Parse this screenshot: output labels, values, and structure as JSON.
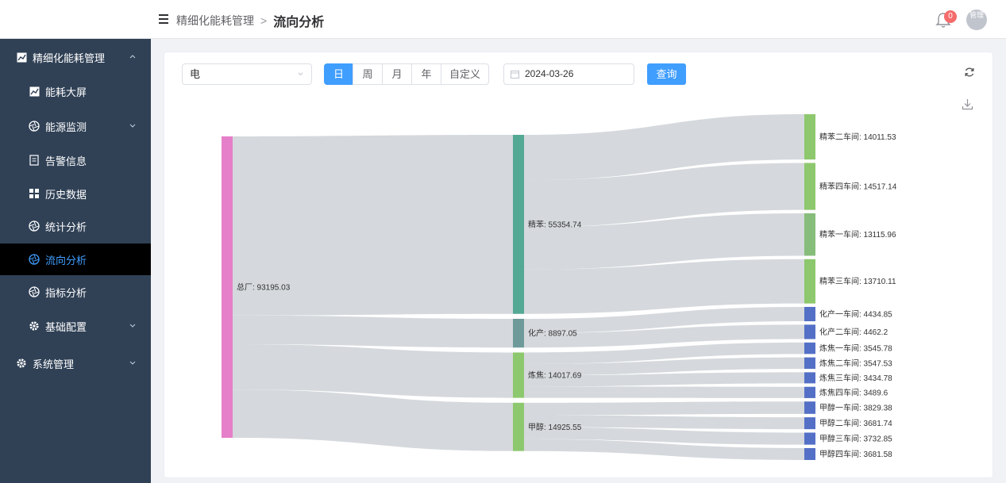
{
  "header": {
    "breadcrumb_parent": "精细化能耗管理",
    "breadcrumb_sep": ">",
    "breadcrumb_current": "流向分析",
    "notification_count": "0",
    "avatar_text": "管理"
  },
  "sidebar": {
    "items": [
      {
        "label": "精细化能耗管理",
        "icon": "line-chart-icon",
        "level": "top",
        "expanded": true
      },
      {
        "label": "能耗大屏",
        "icon": "line-chart-icon",
        "level": "sub"
      },
      {
        "label": "能源监测",
        "icon": "aperture-icon",
        "level": "sub",
        "expandable": true
      },
      {
        "label": "告警信息",
        "icon": "document-icon",
        "level": "sub"
      },
      {
        "label": "历史数据",
        "icon": "grid-icon",
        "level": "sub"
      },
      {
        "label": "统计分析",
        "icon": "aperture-icon",
        "level": "sub"
      },
      {
        "label": "流向分析",
        "icon": "aperture-icon",
        "level": "sub",
        "active": true
      },
      {
        "label": "指标分析",
        "icon": "aperture-icon",
        "level": "sub"
      },
      {
        "label": "基础配置",
        "icon": "gear-icon",
        "level": "sub",
        "expandable": true
      },
      {
        "label": "系统管理",
        "icon": "gear-icon",
        "level": "top",
        "expandable": true
      }
    ]
  },
  "toolbar": {
    "energy_type": "电",
    "periods": [
      "日",
      "周",
      "月",
      "年",
      "自定义"
    ],
    "active_period": "日",
    "date_value": "2024-03-26",
    "query_label": "查询"
  },
  "chart_data": {
    "type": "sankey",
    "nodes": [
      {
        "name": "总厂",
        "value": 93195.03,
        "color": "#e67fca"
      },
      {
        "name": "精苯",
        "value": 55354.74,
        "color": "#54a994"
      },
      {
        "name": "化产",
        "value": 8897.05,
        "color": "#6f9a9a"
      },
      {
        "name": "炼焦",
        "value": 14017.69,
        "color": "#8dc86e"
      },
      {
        "name": "甲醇",
        "value": 14925.55,
        "color": "#8dc86e"
      },
      {
        "name": "精苯二车间",
        "value": 14011.53,
        "color": "#8dc86e"
      },
      {
        "name": "精苯四车间",
        "value": 14517.14,
        "color": "#8dc86e"
      },
      {
        "name": "精苯一车间",
        "value": 13115.96,
        "color": "#86bd7a"
      },
      {
        "name": "精苯三车间",
        "value": 13710.11,
        "color": "#8dc86e"
      },
      {
        "name": "化产一车间",
        "value": 4434.85,
        "color": "#5470c6"
      },
      {
        "name": "化产二车间",
        "value": 4462.2,
        "color": "#5470c6"
      },
      {
        "name": "炼焦一车间",
        "value": 3545.78,
        "color": "#5470c6"
      },
      {
        "name": "炼焦二车间",
        "value": 3547.53,
        "color": "#5470c6"
      },
      {
        "name": "炼焦三车间",
        "value": 3434.78,
        "color": "#5470c6"
      },
      {
        "name": "炼焦四车间",
        "value": 3489.6,
        "color": "#5470c6"
      },
      {
        "name": "甲醇一车间",
        "value": 3829.38,
        "color": "#5470c6"
      },
      {
        "name": "甲醇二车间",
        "value": 3681.74,
        "color": "#5470c6"
      },
      {
        "name": "甲醇三车间",
        "value": 3732.85,
        "color": "#5470c6"
      },
      {
        "name": "甲醇四车间",
        "value": 3681.58,
        "color": "#5470c6"
      }
    ],
    "links": [
      {
        "source": "总厂",
        "target": "精苯",
        "value": 55354.74
      },
      {
        "source": "总厂",
        "target": "化产",
        "value": 8897.05
      },
      {
        "source": "总厂",
        "target": "炼焦",
        "value": 14017.69
      },
      {
        "source": "总厂",
        "target": "甲醇",
        "value": 14925.55
      },
      {
        "source": "精苯",
        "target": "精苯二车间",
        "value": 14011.53
      },
      {
        "source": "精苯",
        "target": "精苯四车间",
        "value": 14517.14
      },
      {
        "source": "精苯",
        "target": "精苯一车间",
        "value": 13115.96
      },
      {
        "source": "精苯",
        "target": "精苯三车间",
        "value": 13710.11
      },
      {
        "source": "化产",
        "target": "化产一车间",
        "value": 4434.85
      },
      {
        "source": "化产",
        "target": "化产二车间",
        "value": 4462.2
      },
      {
        "source": "炼焦",
        "target": "炼焦一车间",
        "value": 3545.78
      },
      {
        "source": "炼焦",
        "target": "炼焦二车间",
        "value": 3547.53
      },
      {
        "source": "炼焦",
        "target": "炼焦三车间",
        "value": 3434.78
      },
      {
        "source": "炼焦",
        "target": "炼焦四车间",
        "value": 3489.6
      },
      {
        "source": "甲醇",
        "target": "甲醇一车间",
        "value": 3829.38
      },
      {
        "source": "甲醇",
        "target": "甲醇二车间",
        "value": 3681.74
      },
      {
        "source": "甲醇",
        "target": "甲醇三车间",
        "value": 3732.85
      },
      {
        "source": "甲醇",
        "target": "甲醇四车间",
        "value": 3681.58
      }
    ],
    "link_color": "#d3d6da"
  }
}
